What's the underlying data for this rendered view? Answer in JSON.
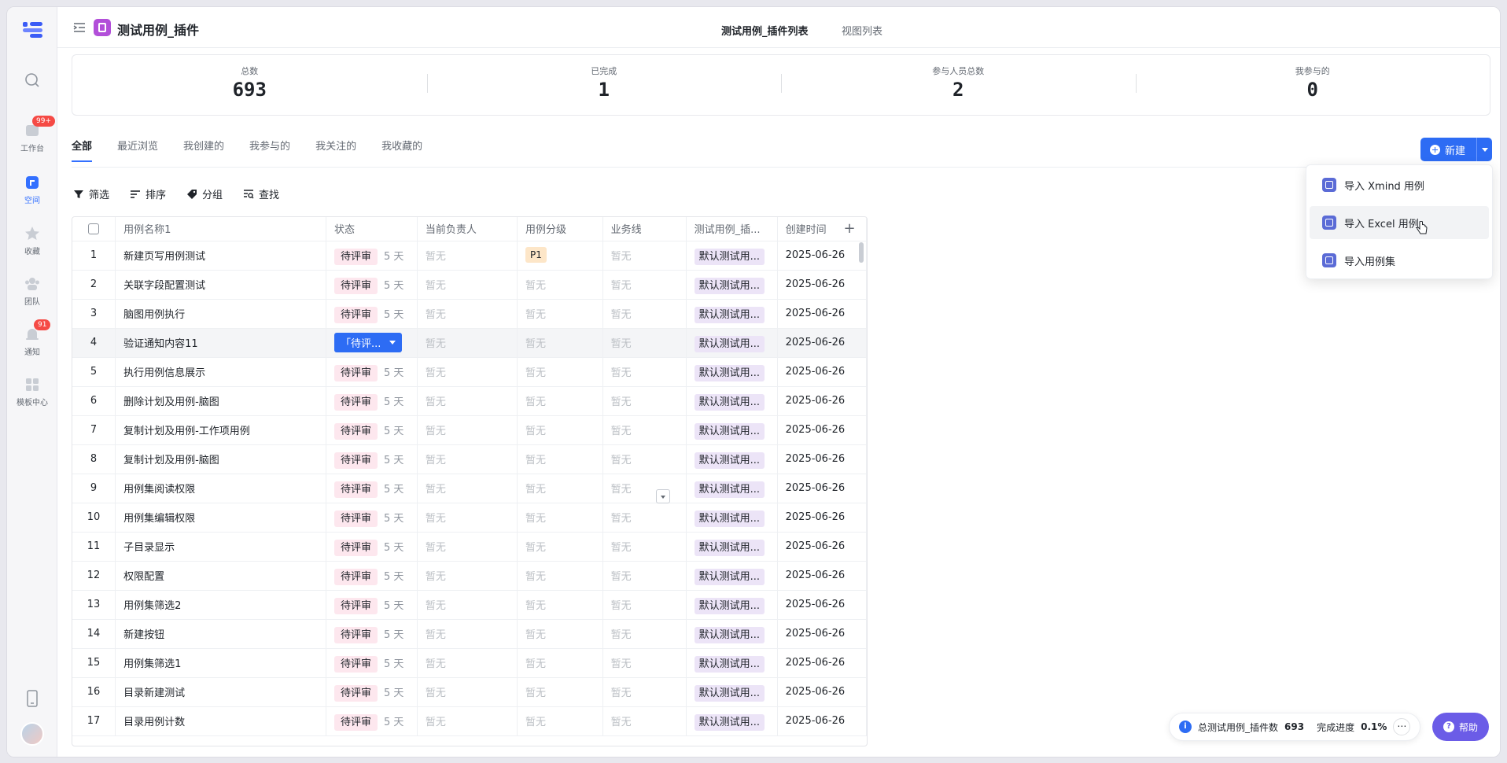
{
  "app": {
    "title": "测试用例_插件",
    "tabs": [
      "测试用例_插件列表",
      "视图列表"
    ]
  },
  "rail": {
    "items": [
      {
        "label": "",
        "icon": "search-icon"
      },
      {
        "label": "工作台",
        "icon": "workbench-icon",
        "badge": "99+"
      },
      {
        "label": "空间",
        "icon": "space-icon"
      },
      {
        "label": "收藏",
        "icon": "star-icon"
      },
      {
        "label": "团队",
        "icon": "team-icon"
      },
      {
        "label": "通知",
        "icon": "bell-icon",
        "badge": "91"
      },
      {
        "label": "模板中心",
        "icon": "template-icon"
      }
    ]
  },
  "stats": [
    {
      "label": "总数",
      "value": "693"
    },
    {
      "label": "已完成",
      "value": "1"
    },
    {
      "label": "参与人员总数",
      "value": "2"
    },
    {
      "label": "我参与的",
      "value": "0"
    }
  ],
  "view_tabs": [
    "全部",
    "最近浏览",
    "我创建的",
    "我参与的",
    "我关注的",
    "我收藏的"
  ],
  "new_button": "新建",
  "toolbar": {
    "filter": "筛选",
    "sort": "排序",
    "group": "分组",
    "find": "查找"
  },
  "table": {
    "columns": [
      "用例名称1",
      "状态",
      "当前负责人",
      "用例分级",
      "业务线",
      "测试用例_插...",
      "创建时间"
    ],
    "empty_text": "暂无",
    "rows": [
      {
        "idx": "1",
        "name": "新建页写用例测试",
        "status": "待评审",
        "days": "5 天",
        "grade": "P1",
        "set": "默认测试用...",
        "date": "2025-06-26"
      },
      {
        "idx": "2",
        "name": "关联字段配置测试",
        "status": "待评审",
        "days": "5 天",
        "grade": "",
        "set": "默认测试用...",
        "date": "2025-06-26"
      },
      {
        "idx": "3",
        "name": "脑图用例执行",
        "status": "待评审",
        "days": "5 天",
        "grade": "",
        "set": "默认测试用...",
        "date": "2025-06-26"
      },
      {
        "idx": "4",
        "name": "验证通知内容11",
        "status": "「待评...",
        "days": "",
        "grade": "",
        "set": "默认测试用...",
        "date": "2025-06-26"
      },
      {
        "idx": "5",
        "name": "执行用例信息展示",
        "status": "待评审",
        "days": "5 天",
        "grade": "",
        "set": "默认测试用...",
        "date": "2025-06-26"
      },
      {
        "idx": "6",
        "name": "删除计划及用例-脑图",
        "status": "待评审",
        "days": "5 天",
        "grade": "",
        "set": "默认测试用...",
        "date": "2025-06-26"
      },
      {
        "idx": "7",
        "name": "复制计划及用例-工作项用例",
        "status": "待评审",
        "days": "5 天",
        "grade": "",
        "set": "默认测试用...",
        "date": "2025-06-26"
      },
      {
        "idx": "8",
        "name": "复制计划及用例-脑图",
        "status": "待评审",
        "days": "5 天",
        "grade": "",
        "set": "默认测试用...",
        "date": "2025-06-26"
      },
      {
        "idx": "9",
        "name": "用例集阅读权限",
        "status": "待评审",
        "days": "5 天",
        "grade": "",
        "set": "默认测试用...",
        "date": "2025-06-26"
      },
      {
        "idx": "10",
        "name": "用例集编辑权限",
        "status": "待评审",
        "days": "5 天",
        "grade": "",
        "set": "默认测试用...",
        "date": "2025-06-26"
      },
      {
        "idx": "11",
        "name": "子目录显示",
        "status": "待评审",
        "days": "5 天",
        "grade": "",
        "set": "默认测试用...",
        "date": "2025-06-26"
      },
      {
        "idx": "12",
        "name": "权限配置",
        "status": "待评审",
        "days": "5 天",
        "grade": "",
        "set": "默认测试用...",
        "date": "2025-06-26"
      },
      {
        "idx": "13",
        "name": "用例集筛选2",
        "status": "待评审",
        "days": "5 天",
        "grade": "",
        "set": "默认测试用...",
        "date": "2025-06-26"
      },
      {
        "idx": "14",
        "name": "新建按钮",
        "status": "待评审",
        "days": "5 天",
        "grade": "",
        "set": "默认测试用...",
        "date": "2025-06-26"
      },
      {
        "idx": "15",
        "name": "用例集筛选1",
        "status": "待评审",
        "days": "5 天",
        "grade": "",
        "set": "默认测试用...",
        "date": "2025-06-26"
      },
      {
        "idx": "16",
        "name": "目录新建测试",
        "status": "待评审",
        "days": "5 天",
        "grade": "",
        "set": "默认测试用...",
        "date": "2025-06-26"
      },
      {
        "idx": "17",
        "name": "目录用例计数",
        "status": "待评审",
        "days": "5 天",
        "grade": "",
        "set": "默认测试用...",
        "date": "2025-06-26"
      }
    ]
  },
  "dropdown": [
    "导入 Xmind 用例",
    "导入 Excel 用例",
    "导入用例集"
  ],
  "footer": {
    "total_label": "总测试用例_插件数",
    "total_value": "693",
    "progress_label": "完成进度",
    "progress_value": "0.1%",
    "help": "帮助"
  },
  "colors": {
    "accent": "#2d6cf4",
    "status_pill": "#fde7ee",
    "help": "#6b5ce7"
  }
}
